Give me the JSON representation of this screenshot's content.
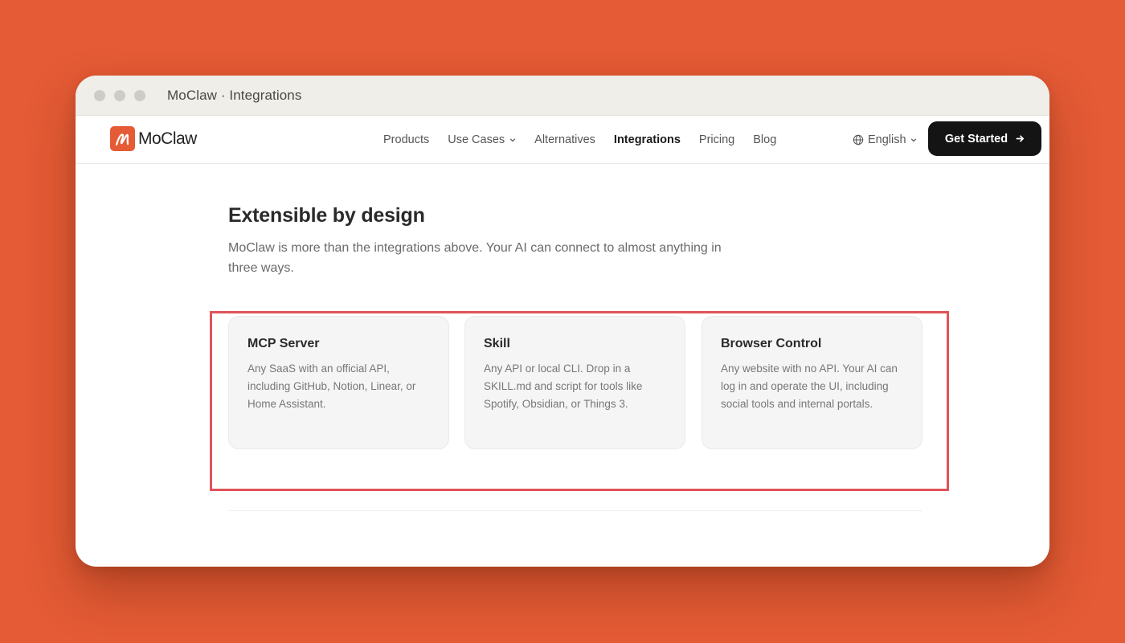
{
  "window": {
    "title": "MoClaw · Integrations"
  },
  "brand": {
    "name": "MoClaw",
    "accent": "#e45b35"
  },
  "nav": {
    "items": [
      {
        "label": "Products"
      },
      {
        "label": "Use Cases"
      },
      {
        "label": "Alternatives"
      },
      {
        "label": "Integrations"
      },
      {
        "label": "Pricing"
      },
      {
        "label": "Blog"
      }
    ],
    "active": "Integrations",
    "language": "English",
    "cta": "Get Started"
  },
  "section": {
    "title": "Extensible by design",
    "description": "MoClaw is more than the integrations above. Your AI can connect to almost anything in three ways.",
    "cards": [
      {
        "title": "MCP Server",
        "body": "Any SaaS with an official API, including GitHub, Notion, Linear, or Home Assistant."
      },
      {
        "title": "Skill",
        "body": "Any API or local CLI. Drop in a SKILL.md and script for tools like Spotify, Obsidian, or Things 3."
      },
      {
        "title": "Browser Control",
        "body": "Any website with no API. Your AI can log in and operate the UI, including social tools and internal portals."
      }
    ]
  },
  "colors": {
    "background": "#e45b35",
    "highlight": "#e05459",
    "button": "#141414"
  }
}
